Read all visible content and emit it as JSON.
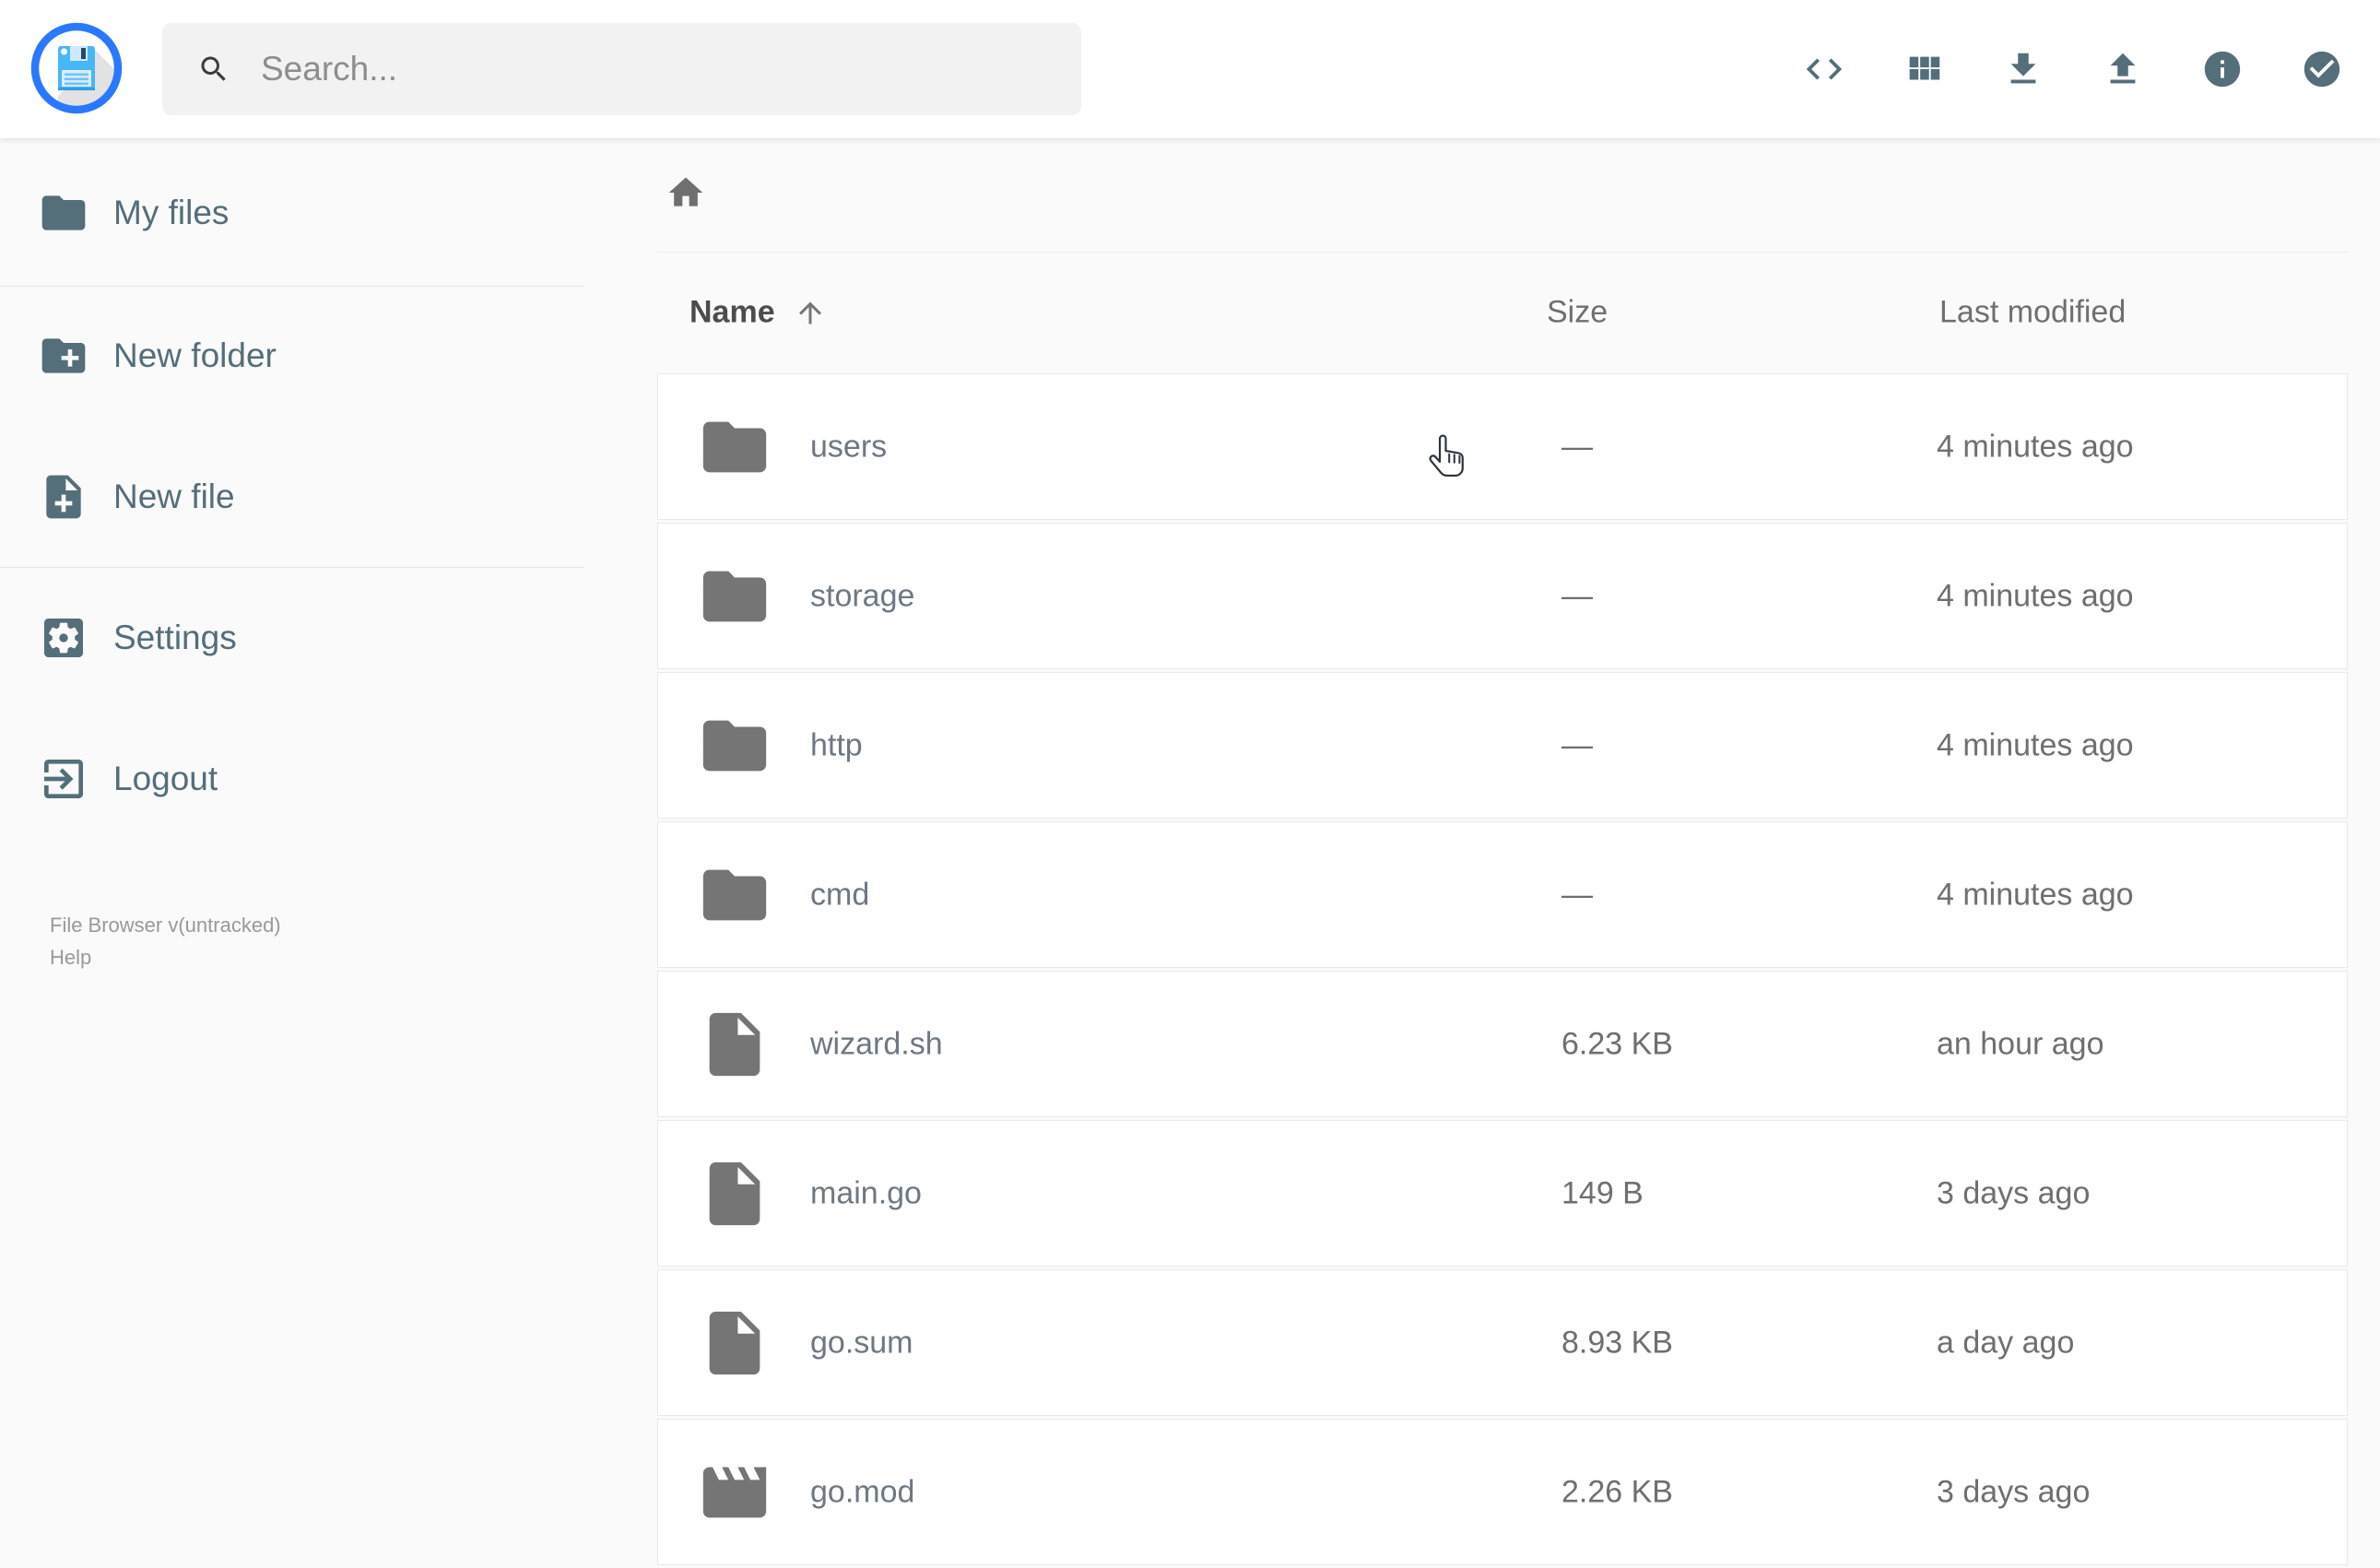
{
  "header": {
    "search_placeholder": "Search...",
    "toolbar_icons": [
      "code-icon",
      "view-module-icon",
      "download-icon",
      "upload-icon",
      "info-icon",
      "select-multiple-icon"
    ]
  },
  "sidebar": {
    "items": [
      {
        "label": "My files",
        "icon": "folder-icon"
      },
      {
        "label": "New folder",
        "icon": "new-folder-icon"
      },
      {
        "label": "New file",
        "icon": "new-file-icon"
      },
      {
        "label": "Settings",
        "icon": "settings-icon"
      },
      {
        "label": "Logout",
        "icon": "logout-icon"
      }
    ],
    "version": "File Browser v(untracked)",
    "help": "Help"
  },
  "breadcrumb": {
    "home_icon": "home-icon"
  },
  "listing": {
    "columns": {
      "name": "Name",
      "size": "Size",
      "modified": "Last modified"
    },
    "sort": {
      "column": "name",
      "direction": "asc"
    },
    "rows": [
      {
        "name": "users",
        "icon": "folder",
        "size": "—",
        "modified": "4 minutes ago"
      },
      {
        "name": "storage",
        "icon": "folder",
        "size": "—",
        "modified": "4 minutes ago"
      },
      {
        "name": "http",
        "icon": "folder",
        "size": "—",
        "modified": "4 minutes ago"
      },
      {
        "name": "cmd",
        "icon": "folder",
        "size": "—",
        "modified": "4 minutes ago"
      },
      {
        "name": "wizard.sh",
        "icon": "file",
        "size": "6.23 KB",
        "modified": "an hour ago"
      },
      {
        "name": "main.go",
        "icon": "file",
        "size": "149 B",
        "modified": "3 days ago"
      },
      {
        "name": "go.sum",
        "icon": "file",
        "size": "8.93 KB",
        "modified": "a day ago"
      },
      {
        "name": "go.mod",
        "icon": "movie",
        "size": "2.26 KB",
        "modified": "3 days ago"
      }
    ]
  },
  "colors": {
    "accent": "#546e7a",
    "logo_ring": "#2979ff",
    "floppy_blue": "#47b7f8",
    "row_icon": "#757575"
  }
}
